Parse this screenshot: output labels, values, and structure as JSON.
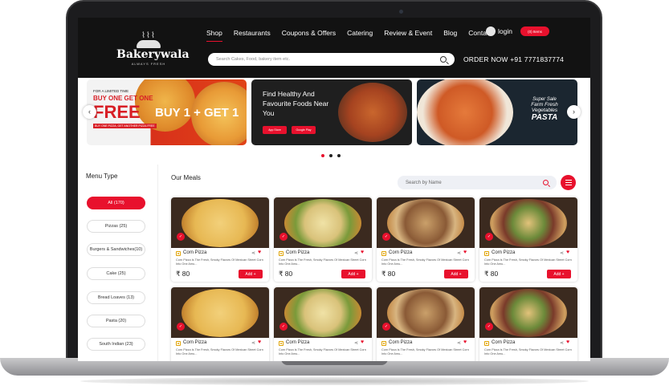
{
  "header": {
    "logo_name": "Bakerywala",
    "logo_tagline": "ALWAYS FRESH",
    "nav": [
      "Shop",
      "Restaurants",
      "Coupons & Offers",
      "Catering",
      "Review & Event",
      "Blog",
      "Contact"
    ],
    "login_label": "login",
    "cart_label": "(0) Items",
    "search_placeholder": "Search Cakes, Food, bakery item etc.",
    "order_text": "ORDER NOW +91 7771837774"
  },
  "banners": {
    "b1_small": "FOR A LIMITED TIME",
    "b1_line1": "BUY ONE GET ONE",
    "b1_line2": "FREE",
    "b1_sub": "BUY ONE PIZZA, GET ANOTHER PIZZA FREE",
    "b1_buy": "BUY 1 + GET 1",
    "b2_text": "Find Healthy And Favourite Foods Near You",
    "b2_store1": "App Store",
    "b2_store2": "Google Play",
    "b3_l1": "Super Sale",
    "b3_l2": "Farm Fresh Vegetables",
    "b3_l3": "PASTA"
  },
  "sidebar": {
    "title": "Menu Type",
    "items": [
      {
        "label": "All (170)",
        "active": true
      },
      {
        "label": "Pizzas (25)"
      },
      {
        "label": "Burgers & Sandwiches(10)"
      },
      {
        "label": "Cake (25)"
      },
      {
        "label": "Bread Loaves (13)"
      },
      {
        "label": "Pasta (20)"
      },
      {
        "label": "South Indian (23)"
      }
    ]
  },
  "meals": {
    "title": "Our Meals",
    "search_placeholder": "Search by Name",
    "cards": [
      {
        "name": "Corn Pizza",
        "desc": "Corn Pizza Is The Fresh, Smoky Flavors Of Mexican Street Corn Into One Amu...",
        "price": "₹ 80",
        "add": "Add +"
      },
      {
        "name": "Corn Pizza",
        "desc": "Corn Pizza Is The Fresh, Smoky Flavors Of Mexican Street Corn Into One Amu...",
        "price": "₹ 80",
        "add": "Add +"
      },
      {
        "name": "Corn Pizza",
        "desc": "Corn Pizza Is The Fresh, Smoky Flavors Of Mexican Street Corn Into One Amu...",
        "price": "₹ 80",
        "add": "Add +"
      },
      {
        "name": "Corn Pizza",
        "desc": "Corn Pizza Is The Fresh, Smoky Flavors Of Mexican Street Corn Into One Amu...",
        "price": "₹ 80",
        "add": "Add +"
      },
      {
        "name": "Corn Pizza",
        "desc": "Corn Pizza Is The Fresh, Smoky Flavors Of Mexican Street Corn Into One Amu..."
      },
      {
        "name": "Corn Pizza",
        "desc": "Corn Pizza Is The Fresh, Smoky Flavors Of Mexican Street Corn Into One Amu..."
      },
      {
        "name": "Corn Pizza",
        "desc": "Corn Pizza Is The Fresh, Smoky Flavors Of Mexican Street Corn Into One Amu..."
      },
      {
        "name": "Corn Pizza",
        "desc": "Corn Pizza Is The Fresh, Smoky Flavors Of Mexican Street Corn Into One Amu..."
      }
    ]
  },
  "colors": {
    "accent": "#e8112d",
    "header_bg": "#121212"
  }
}
